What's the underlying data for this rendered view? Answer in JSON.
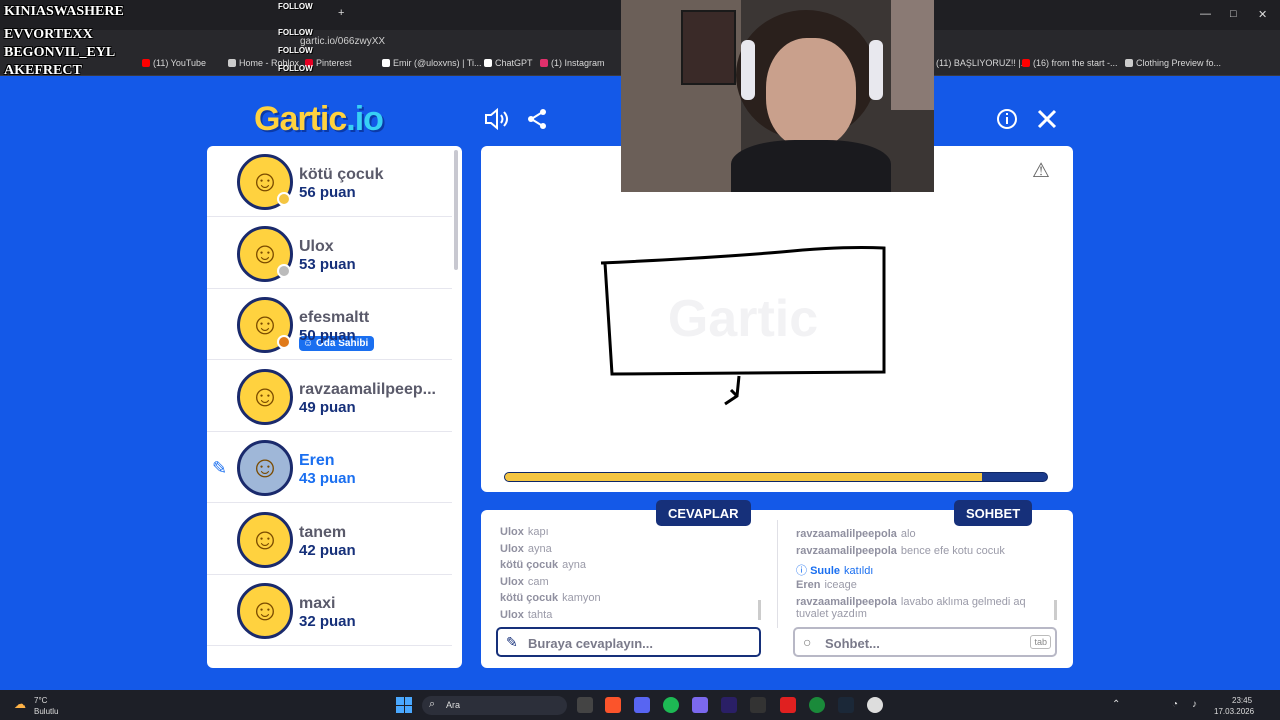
{
  "browser": {
    "url": "gartic.io/066zwyXX",
    "bookmarks": [
      {
        "label": "(11) YouTube",
        "color": "#ff0000"
      },
      {
        "label": "Home - Roblox",
        "color": "#cccccc"
      },
      {
        "label": "Pinterest",
        "color": "#e60023"
      },
      {
        "label": "Emir (@uloxvns) | Ti...",
        "color": "#ffffff"
      },
      {
        "label": "ChatGPT",
        "color": "#ffffff"
      },
      {
        "label": "(1) Instagram",
        "color": "#e1306c"
      },
      {
        "label": "(11) BAŞLIYORUZ!! |...",
        "color": "#ff0000"
      },
      {
        "label": "(16) from the start -...",
        "color": "#ff0000"
      },
      {
        "label": "Clothing Preview fo...",
        "color": "#cccccc"
      }
    ]
  },
  "stream_overlay": {
    "names": [
      "KINIASWASHERE",
      "EVVORTEXX",
      "BEGONVIL_EYL",
      "AKEFRECT"
    ],
    "follow": "FOLLOW"
  },
  "game": {
    "logo_main": "Gartic",
    "logo_suffix": ".io",
    "players": [
      {
        "name": "kötü çocuk",
        "score": "56 puan",
        "status_color": "#f4c542"
      },
      {
        "name": "Ulox",
        "score": "53 puan",
        "status_color": "#bbbbbb",
        "badge": "Oda Sahibi"
      },
      {
        "name": "efesmaltt",
        "score": "50 puan",
        "status_color": "#e07a1a"
      },
      {
        "name": "ravzaamalilpeep...",
        "score": "49 puan",
        "status_color": ""
      },
      {
        "name": "Eren",
        "score": "43 puan",
        "status_color": "",
        "drawing": true
      },
      {
        "name": "tanem",
        "score": "42 puan",
        "status_color": ""
      },
      {
        "name": "maxi",
        "score": "32 puan",
        "status_color": ""
      }
    ],
    "progress_fraction": 0.88,
    "tabs": {
      "answers": "CEVAPLAR",
      "chat": "SOHBET"
    },
    "answers": [
      {
        "user": "Ulox",
        "text": "kapı"
      },
      {
        "user": "Ulox",
        "text": "ayna"
      },
      {
        "user": "kötü çocuk",
        "text": "ayna"
      },
      {
        "user": "Ulox",
        "text": "cam"
      },
      {
        "user": "kötü çocuk",
        "text": "kamyon"
      },
      {
        "user": "Ulox",
        "text": "tahta"
      }
    ],
    "chat": [
      {
        "user": "ravzaamalilpeepola",
        "text": "alo"
      },
      {
        "user": "ravzaamalilpeepola",
        "text": "bence efe kotu cocuk"
      },
      {
        "user": "Suule",
        "text": "katıldı",
        "system": true
      },
      {
        "user": "Eren",
        "text": "iceage"
      },
      {
        "user": "ravzaamalilpeepola",
        "text": "lavabo aklıma gelmedi aq"
      },
      {
        "user": "",
        "text": "tuvalet yazdım"
      }
    ],
    "answer_placeholder": "Buraya cevaplayın...",
    "chat_placeholder": "Sohbet...",
    "tab_key": "tab"
  },
  "taskbar": {
    "weather_temp": "7°C",
    "weather_desc": "Bulutlu",
    "search": "Ara",
    "time": "23:45",
    "date": "17.03.2026"
  }
}
